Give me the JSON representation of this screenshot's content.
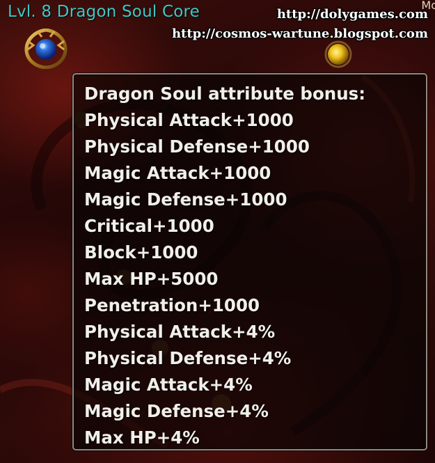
{
  "item": {
    "title": "Lvl. 8 Dragon Soul Core",
    "icon": "dragon-soul-core-icon"
  },
  "watermarks": [
    "http://dolygames.com",
    "http://cosmos-wartune.blogspot.com"
  ],
  "top_right_fragment": "Mo",
  "tooltip": {
    "heading": "Dragon Soul attribute bonus:",
    "bonuses": [
      "Physical Attack+1000",
      "Physical Defense+1000",
      "Magic Attack+1000",
      "Magic Defense+1000",
      "Critical+1000",
      "Block+1000",
      "Max HP+5000",
      "Penetration+1000",
      "Physical Attack+4%",
      "Physical Defense+4%",
      "Magic Attack+4%",
      "Magic Defense+4%",
      "Max HP+4%"
    ]
  },
  "colors": {
    "title": "#3ec9c6",
    "tooltip_text": "#f1efe9",
    "tooltip_border": "#8f8a80",
    "background": "#240707"
  }
}
